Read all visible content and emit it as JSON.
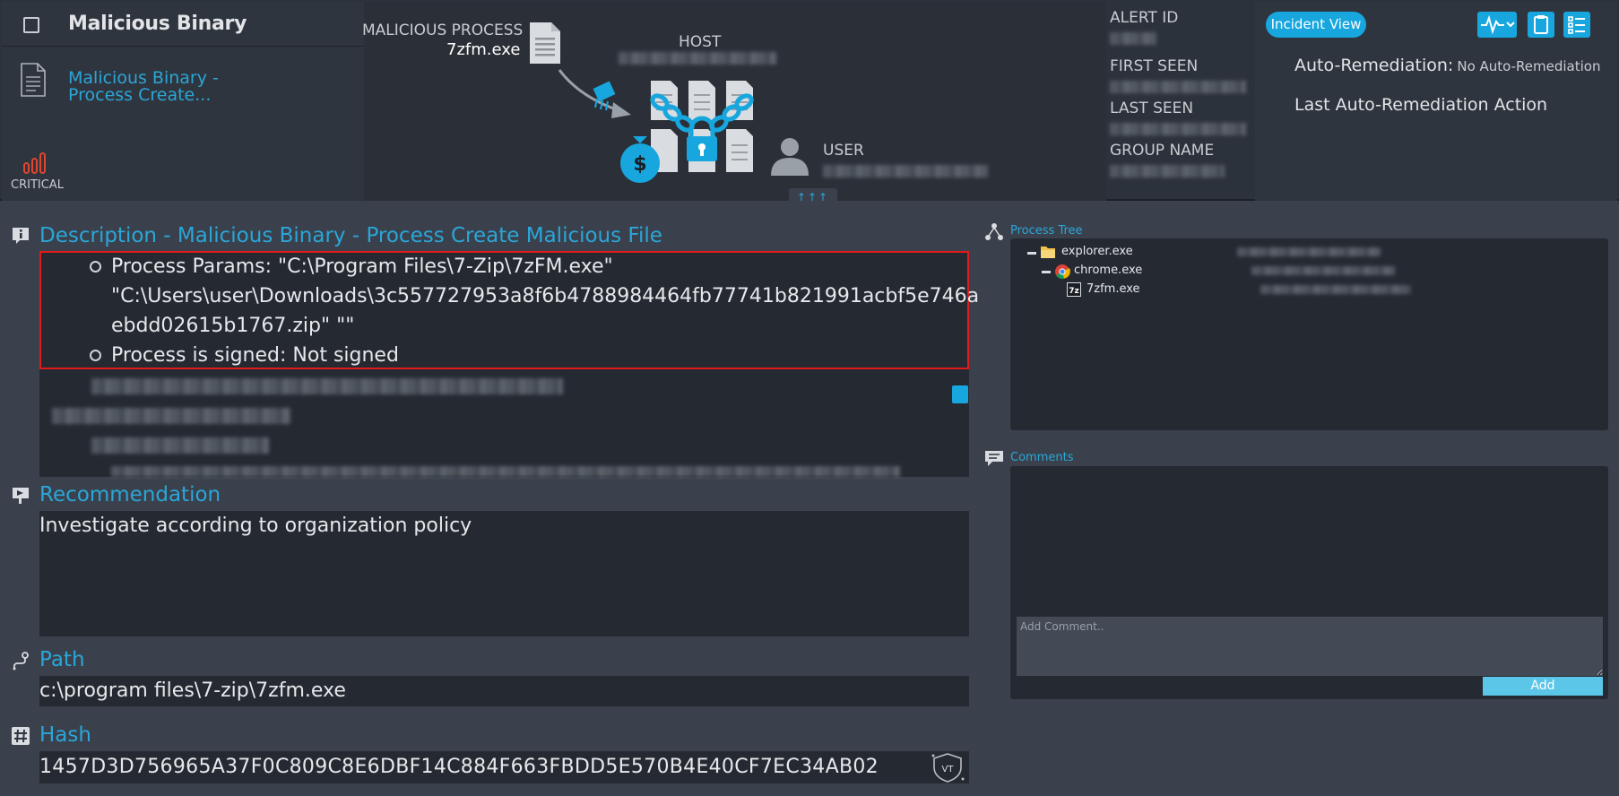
{
  "header": {
    "alert_title": "Malicious Binary",
    "rule_name_line1": "Malicious Binary -",
    "rule_name_line2": "Process Create...",
    "severity_label": "CRITICAL",
    "malicious_process_label": "MALICIOUS PROCESS",
    "malicious_process_name": "7zfm.exe",
    "host_label": "HOST",
    "user_label": "USER",
    "expand_label": "↑↑↑",
    "alert_id_label": "ALERT ID",
    "first_seen_label": "FIRST SEEN",
    "last_seen_label": "LAST SEEN",
    "group_name_label": "GROUP NAME",
    "incident_view_label": "Incident View",
    "auto_remediation_label": "Auto-Remediation:",
    "auto_remediation_value": "No Auto-Remediation",
    "last_auto_remediation_label": "Last Auto-Remediation Action"
  },
  "description": {
    "title": "Description - Malicious Binary - Process Create Malicious File",
    "params_line1": "Process Params: \"C:\\Program Files\\7-Zip\\7zFM.exe\"",
    "params_line2": "\"C:\\Users\\user\\Downloads\\3c557727953a8f6b4788984464fb77741b821991acbf5e746a",
    "params_line3": "ebdd02615b1767.zip\" \"\"",
    "signed_line": "Process is signed: Not signed"
  },
  "recommendation": {
    "title": "Recommendation",
    "text": "Investigate according to organization policy"
  },
  "path": {
    "title": "Path",
    "value": "c:\\program files\\7-zip\\7zfm.exe"
  },
  "hash": {
    "title": "Hash",
    "value": "1457D3D756965A37F0C809C8E6DBF14C884F663FBDD5E570B4E40CF7EC34AB02",
    "vt_label": "VT"
  },
  "process_tree": {
    "title": "Process Tree",
    "nodes": [
      "explorer.exe",
      "chrome.exe",
      "7zfm.exe"
    ]
  },
  "comments": {
    "title": "Comments",
    "placeholder": "Add Comment..",
    "add_label": "Add"
  },
  "colors": {
    "accent": "#17a7de",
    "highlight_border": "#e11a1a",
    "severity": "#e0452f"
  }
}
